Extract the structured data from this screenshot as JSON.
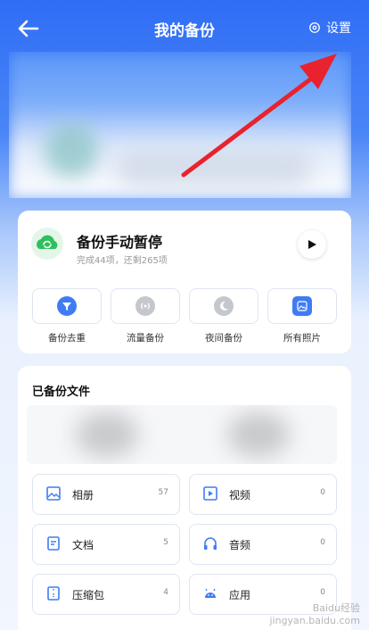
{
  "header": {
    "title": "我的备份",
    "settings_label": "设置"
  },
  "status_card": {
    "title": "备份手动暂停",
    "subtitle": "完成44项，还剩265项",
    "actions": [
      {
        "label": "备份去重",
        "icon": "filter-icon",
        "color": "#3f7cf4"
      },
      {
        "label": "流量备份",
        "icon": "signal-icon",
        "color": "#c4c7cc"
      },
      {
        "label": "夜间备份",
        "icon": "moon-icon",
        "color": "#c4c7cc"
      },
      {
        "label": "所有照片",
        "icon": "photo-icon",
        "color": "#3f7cf4"
      }
    ]
  },
  "files_card": {
    "title": "已备份文件",
    "items": [
      {
        "label": "相册",
        "count": "57",
        "icon": "album-icon"
      },
      {
        "label": "视频",
        "count": "0",
        "icon": "video-icon"
      },
      {
        "label": "文档",
        "count": "5",
        "icon": "document-icon"
      },
      {
        "label": "音频",
        "count": "0",
        "icon": "headphones-icon"
      },
      {
        "label": "压缩包",
        "count": "4",
        "icon": "archive-icon"
      },
      {
        "label": "应用",
        "count": "0",
        "icon": "android-icon"
      }
    ]
  },
  "colors": {
    "accent": "#3f7cf4",
    "arrow": "#e8232e",
    "header_bg": "#2f6df5"
  },
  "watermark": {
    "text": "Baidu经验\njingyan.baidu.com"
  }
}
